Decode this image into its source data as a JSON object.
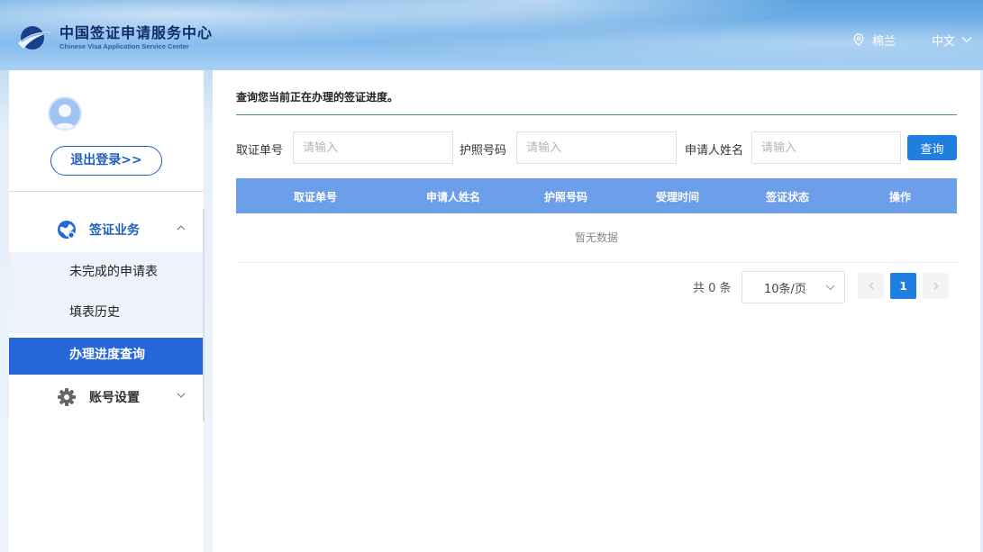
{
  "header": {
    "logo_cn": "中国签证申请服务中心",
    "logo_en": "Chinese Visa Application Service Center",
    "city": "棉兰",
    "language": "中文"
  },
  "sidebar": {
    "logout_label": "退出登录>>",
    "visa_group_label": "签证业务",
    "items": [
      {
        "label": "未完成的申请表"
      },
      {
        "label": "填表历史"
      },
      {
        "label": "办理进度查询"
      }
    ],
    "account_group_label": "账号设置"
  },
  "main": {
    "title": "查询您当前正在办理的签证进度。",
    "filters": {
      "pickup_label": "取证单号",
      "passport_label": "护照号码",
      "name_label": "申请人姓名",
      "placeholder": "请输入",
      "search_label": "查询"
    },
    "table": {
      "columns": [
        "取证单号",
        "申请人姓名",
        "护照号码",
        "受理时间",
        "签证状态",
        "操作"
      ],
      "empty_text": "暂无数据"
    },
    "pagination": {
      "total_text": "共 0 条",
      "page_size": "10条/页",
      "current_page": "1"
    }
  },
  "colors": {
    "primary": "#1e7fe0",
    "active_nav": "#2566d8",
    "table_header": "#6d9eea",
    "brand_navy": "#0d2b6b"
  }
}
